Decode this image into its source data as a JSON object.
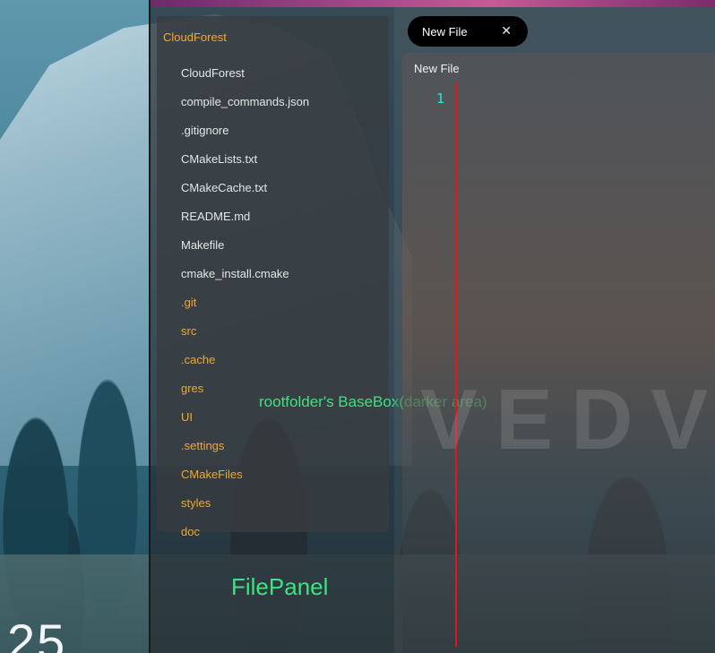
{
  "desktop": {
    "clock_fragment": "25"
  },
  "file_panel": {
    "root_folder": "CloudForest",
    "items": [
      {
        "name": "CloudForest",
        "kind": "file"
      },
      {
        "name": "compile_commands.json",
        "kind": "file"
      },
      {
        "name": ".gitignore",
        "kind": "file"
      },
      {
        "name": "CMakeLists.txt",
        "kind": "file"
      },
      {
        "name": "CMakeCache.txt",
        "kind": "file"
      },
      {
        "name": "README.md",
        "kind": "file"
      },
      {
        "name": "Makefile",
        "kind": "file"
      },
      {
        "name": "cmake_install.cmake",
        "kind": "file"
      },
      {
        "name": ".git",
        "kind": "folder"
      },
      {
        "name": "src",
        "kind": "folder"
      },
      {
        "name": ".cache",
        "kind": "folder"
      },
      {
        "name": "gres",
        "kind": "folder"
      },
      {
        "name": "UI",
        "kind": "folder"
      },
      {
        "name": ".settings",
        "kind": "folder"
      },
      {
        "name": "CMakeFiles",
        "kind": "folder"
      },
      {
        "name": "styles",
        "kind": "folder"
      },
      {
        "name": "doc",
        "kind": "folder"
      }
    ],
    "basebox_annotation": "rootfolder's BaseBox(darker area)",
    "panel_annotation": "FilePanel"
  },
  "editor": {
    "tab_title": "New File",
    "tab_close_glyph": "✕",
    "panel_title": "New File",
    "line_numbers": [
      "1"
    ]
  },
  "colors": {
    "file_text": "#e6e6e6",
    "folder_text": "#f2a82c",
    "annotation_green": "#3ee27f",
    "line_number": "#36e0df",
    "cursor_line": "#e3161a",
    "tab_background": "#000000"
  }
}
